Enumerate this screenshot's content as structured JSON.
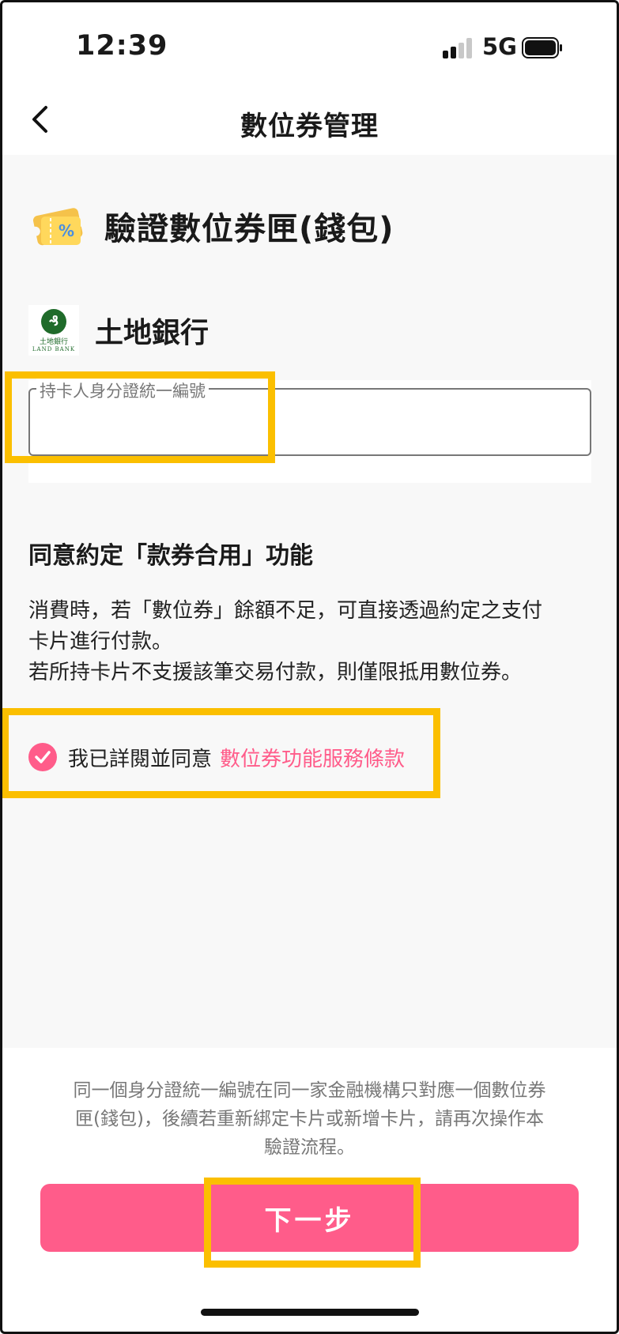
{
  "status_bar": {
    "time": "12:39",
    "network": "5G"
  },
  "nav": {
    "title": "數位券管理"
  },
  "section": {
    "title": "驗證數位券匣(錢包)",
    "icon": "ticket-percent-icon"
  },
  "bank": {
    "name": "土地銀行",
    "logo_zh": "土地銀行",
    "logo_en": "LAND BANK"
  },
  "id_field": {
    "label": "持卡人身分證統一編號",
    "value": ""
  },
  "agreement": {
    "title": "同意約定「款券合用」功能",
    "desc_line1": "消費時，若「數位券」餘額不足，可直接透過約定之支付",
    "desc_line2": "卡片進行付款。",
    "desc_line3": "若所持卡片不支援該筆交易付款，則僅限抵用數位券。"
  },
  "consent": {
    "text": "我已詳閱並同意",
    "link": "數位券功能服務條款",
    "checked": true
  },
  "bottom": {
    "note_line1": "同一個身分證統一編號在同一家金融機構只對應一個數位券",
    "note_line2": "匣(錢包)，後續若重新綁定卡片或新增卡片，請再次操作本",
    "note_line3": "驗證流程。",
    "next_label": "下一步"
  },
  "colors": {
    "accent": "#ff5c8a",
    "highlight": "#fbbf00",
    "bank_green": "#1f6b2a"
  }
}
